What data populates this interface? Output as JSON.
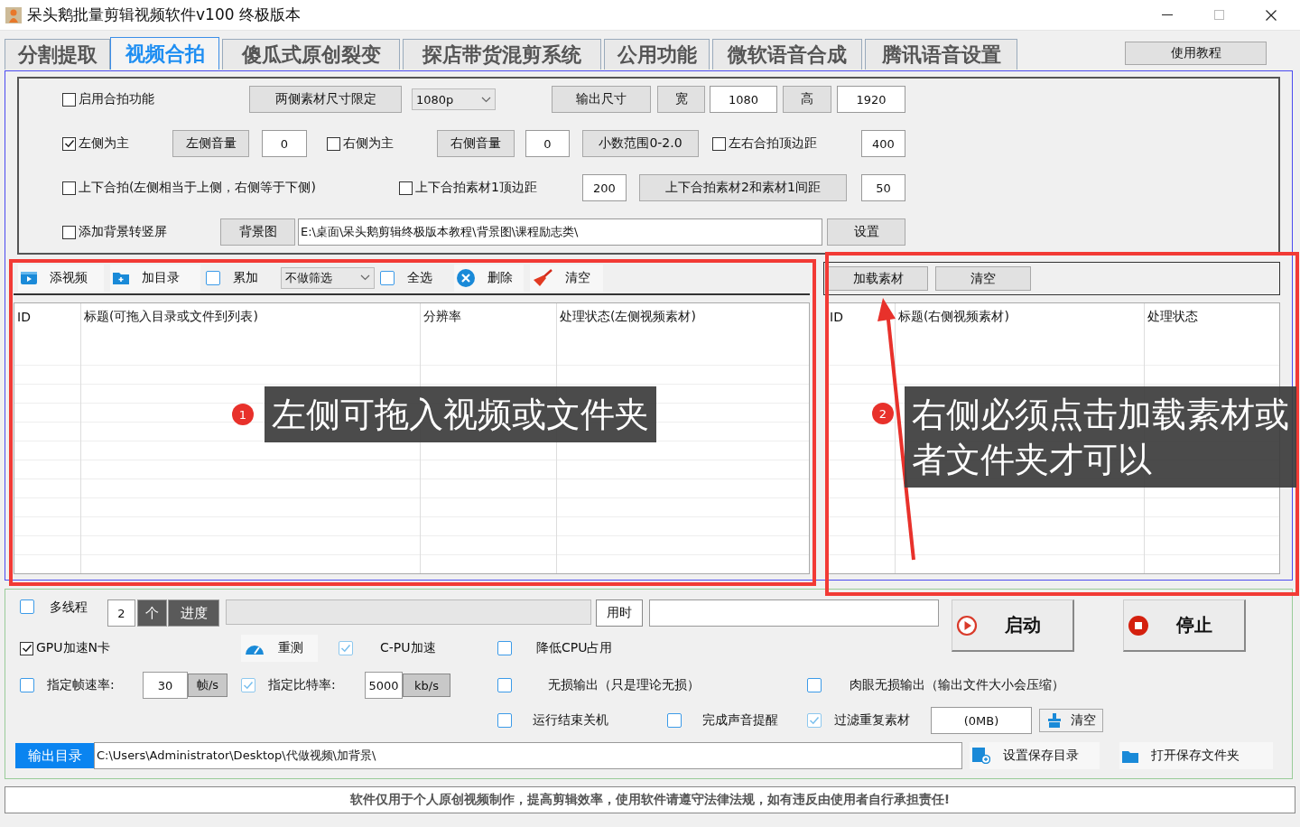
{
  "window": {
    "title": "呆头鹅批量剪辑视频软件v100 终极版本"
  },
  "tabs": [
    {
      "label": "分割提取",
      "selected": false
    },
    {
      "label": "视频合拍",
      "selected": true
    },
    {
      "label": "傻瓜式原创裂变",
      "selected": false
    },
    {
      "label": "探店带货混剪系统",
      "selected": false
    },
    {
      "label": "公用功能",
      "selected": false
    },
    {
      "label": "微软语音合成",
      "selected": false
    },
    {
      "label": "腾讯语音设置",
      "selected": false
    }
  ],
  "help_button": "使用教程",
  "settings": {
    "rows": [
      {
        "items": [
          {
            "kind": "checkbox",
            "label": "启用合拍功能",
            "checked": false
          },
          {
            "kind": "button",
            "label": "两侧素材尺寸限定"
          },
          {
            "kind": "dropdown",
            "value": "1080p"
          },
          {
            "kind": "button",
            "label": "输出尺寸"
          },
          {
            "kind": "button",
            "label": "宽"
          },
          {
            "kind": "field",
            "value": "1080"
          },
          {
            "kind": "button",
            "label": "高"
          },
          {
            "kind": "field",
            "value": "1920"
          }
        ]
      },
      {
        "items": [
          {
            "kind": "checkbox",
            "label": "左侧为主",
            "checked": true
          },
          {
            "kind": "button",
            "label": "左侧音量"
          },
          {
            "kind": "field",
            "value": "0"
          },
          {
            "kind": "checkbox",
            "label": "右侧为主",
            "checked": false
          },
          {
            "kind": "button",
            "label": "右侧音量"
          },
          {
            "kind": "field",
            "value": "0"
          },
          {
            "kind": "button",
            "label": "小数范围0-2.0"
          },
          {
            "kind": "checkbox",
            "label": "左右合拍顶边距",
            "checked": false
          },
          {
            "kind": "field",
            "value": "400"
          }
        ]
      },
      {
        "items": [
          {
            "kind": "checkbox",
            "label": "上下合拍(左侧相当于上侧，右侧等于下侧)",
            "checked": false
          },
          {
            "kind": "checkbox",
            "label": "上下合拍素材1顶边距",
            "checked": false
          },
          {
            "kind": "field",
            "value": "200"
          },
          {
            "kind": "button",
            "label": "上下合拍素材2和素材1间距"
          },
          {
            "kind": "field",
            "value": "50"
          }
        ]
      },
      {
        "items": [
          {
            "kind": "checkbox",
            "label": "添加背景转竖屏",
            "checked": false
          },
          {
            "kind": "button",
            "label": "背景图"
          },
          {
            "kind": "path_field",
            "value": "E:\\桌面\\呆头鹅剪辑终极版本教程\\背景图\\课程励志类\\"
          },
          {
            "kind": "button",
            "label": "设置"
          }
        ]
      }
    ]
  },
  "left_list": {
    "toolbar": [
      {
        "kind": "tool",
        "label": "添视频"
      },
      {
        "kind": "tool",
        "label": "加目录"
      },
      {
        "kind": "flat_checkbox",
        "label": "累加",
        "checked": false
      },
      {
        "kind": "dropdown",
        "value": "不做筛选"
      },
      {
        "kind": "flat_checkbox",
        "label": "全选",
        "checked": false
      },
      {
        "kind": "tool",
        "label": "删除"
      },
      {
        "kind": "tool",
        "label": "清空"
      }
    ],
    "columns": [
      "ID",
      "标题(可拖入目录或文件到列表)",
      "分辨率",
      "处理状态(左侧视频素材)"
    ]
  },
  "right_list": {
    "toolbar": [
      "加载素材",
      "清空"
    ],
    "columns": [
      "ID",
      "标题(右侧视频素材)",
      "处理状态"
    ]
  },
  "annotations": [
    {
      "number": "1",
      "text": "左侧可拖入视频或文件夹"
    },
    {
      "number": "2",
      "text": "右侧必须点击加载素材或者文件夹才可以"
    }
  ],
  "options": {
    "rows": [
      {
        "items": [
          {
            "kind": "flat_checkbox",
            "label": "多线程",
            "checked": false
          },
          {
            "kind": "field",
            "value": "2"
          },
          {
            "kind": "dark_label",
            "label": "个"
          },
          {
            "kind": "dark_label",
            "label": "进度"
          },
          {
            "kind": "progress",
            "level": 0
          },
          {
            "kind": "plain_button",
            "label": "用时"
          },
          {
            "kind": "path_field",
            "value": ""
          },
          {
            "kind": "big_button",
            "label": "启动"
          },
          {
            "kind": "big_button",
            "label": "停止"
          }
        ]
      },
      {
        "items": [
          {
            "kind": "checkbox",
            "label": "GPU加速N卡",
            "checked": true
          },
          {
            "kind": "tool",
            "label": "重测"
          },
          {
            "kind": "flat_checkbox",
            "label": "C-PU加速",
            "checked": true
          },
          {
            "kind": "flat_checkbox",
            "label": "降低CPU占用",
            "checked": false
          }
        ]
      },
      {
        "items": [
          {
            "kind": "flat_checkbox",
            "label": "指定帧速率:",
            "checked": false
          },
          {
            "kind": "field",
            "value": "30"
          },
          {
            "kind": "unit_label",
            "label": "帧/s"
          },
          {
            "kind": "flat_checkbox",
            "label": "指定比特率:",
            "checked": true
          },
          {
            "kind": "field",
            "value": "5000"
          },
          {
            "kind": "unit_label",
            "label": "kb/s"
          },
          {
            "kind": "flat_checkbox",
            "label": "无损输出（只是理论无损）",
            "checked": false
          },
          {
            "kind": "flat_checkbox",
            "label": "肉眼无损输出（输出文件大小会压缩）",
            "checked": false
          }
        ]
      },
      {
        "items": [
          {
            "kind": "flat_checkbox",
            "label": "运行结束关机",
            "checked": false
          },
          {
            "kind": "flat_checkbox",
            "label": "完成声音提醒",
            "checked": false
          },
          {
            "kind": "flat_checkbox",
            "label": "过滤重复素材",
            "checked": true
          },
          {
            "kind": "field",
            "value": "(0MB)"
          },
          {
            "kind": "icon_button",
            "label": "清空"
          }
        ]
      },
      {
        "items": [
          {
            "kind": "blue_label",
            "label": "输出目录"
          },
          {
            "kind": "path_field",
            "value": "C:\\Users\\Administrator\\Desktop\\代做视频\\加背景\\"
          },
          {
            "kind": "tool",
            "label": "设置保存目录"
          },
          {
            "kind": "tool",
            "label": "打开保存文件夹"
          }
        ]
      }
    ]
  },
  "footer": "软件仅用于个人原创视频制作，提高剪辑效率，使用软件请遵守法律法规，如有违反由使用者自行承担责任!"
}
